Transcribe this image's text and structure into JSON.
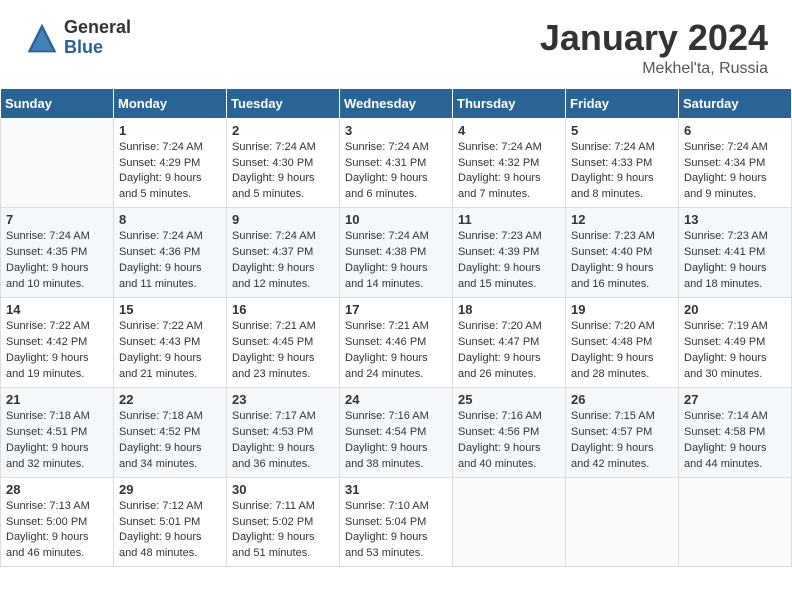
{
  "header": {
    "logo_general": "General",
    "logo_blue": "Blue",
    "month": "January 2024",
    "location": "Mekhel'ta, Russia"
  },
  "weekdays": [
    "Sunday",
    "Monday",
    "Tuesday",
    "Wednesday",
    "Thursday",
    "Friday",
    "Saturday"
  ],
  "weeks": [
    [
      {
        "day": "",
        "info": ""
      },
      {
        "day": "1",
        "info": "Sunrise: 7:24 AM\nSunset: 4:29 PM\nDaylight: 9 hours\nand 5 minutes."
      },
      {
        "day": "2",
        "info": "Sunrise: 7:24 AM\nSunset: 4:30 PM\nDaylight: 9 hours\nand 5 minutes."
      },
      {
        "day": "3",
        "info": "Sunrise: 7:24 AM\nSunset: 4:31 PM\nDaylight: 9 hours\nand 6 minutes."
      },
      {
        "day": "4",
        "info": "Sunrise: 7:24 AM\nSunset: 4:32 PM\nDaylight: 9 hours\nand 7 minutes."
      },
      {
        "day": "5",
        "info": "Sunrise: 7:24 AM\nSunset: 4:33 PM\nDaylight: 9 hours\nand 8 minutes."
      },
      {
        "day": "6",
        "info": "Sunrise: 7:24 AM\nSunset: 4:34 PM\nDaylight: 9 hours\nand 9 minutes."
      }
    ],
    [
      {
        "day": "7",
        "info": ""
      },
      {
        "day": "8",
        "info": "Sunrise: 7:24 AM\nSunset: 4:36 PM\nDaylight: 9 hours\nand 11 minutes."
      },
      {
        "day": "9",
        "info": "Sunrise: 7:24 AM\nSunset: 4:37 PM\nDaylight: 9 hours\nand 12 minutes."
      },
      {
        "day": "10",
        "info": "Sunrise: 7:24 AM\nSunset: 4:38 PM\nDaylight: 9 hours\nand 14 minutes."
      },
      {
        "day": "11",
        "info": "Sunrise: 7:23 AM\nSunset: 4:39 PM\nDaylight: 9 hours\nand 15 minutes."
      },
      {
        "day": "12",
        "info": "Sunrise: 7:23 AM\nSunset: 4:40 PM\nDaylight: 9 hours\nand 16 minutes."
      },
      {
        "day": "13",
        "info": "Sunrise: 7:23 AM\nSunset: 4:41 PM\nDaylight: 9 hours\nand 18 minutes."
      }
    ],
    [
      {
        "day": "14",
        "info": ""
      },
      {
        "day": "15",
        "info": "Sunrise: 7:22 AM\nSunset: 4:43 PM\nDaylight: 9 hours\nand 21 minutes."
      },
      {
        "day": "16",
        "info": "Sunrise: 7:21 AM\nSunset: 4:45 PM\nDaylight: 9 hours\nand 23 minutes."
      },
      {
        "day": "17",
        "info": "Sunrise: 7:21 AM\nSunset: 4:46 PM\nDaylight: 9 hours\nand 24 minutes."
      },
      {
        "day": "18",
        "info": "Sunrise: 7:20 AM\nSunset: 4:47 PM\nDaylight: 9 hours\nand 26 minutes."
      },
      {
        "day": "19",
        "info": "Sunrise: 7:20 AM\nSunset: 4:48 PM\nDaylight: 9 hours\nand 28 minutes."
      },
      {
        "day": "20",
        "info": "Sunrise: 7:19 AM\nSunset: 4:49 PM\nDaylight: 9 hours\nand 30 minutes."
      }
    ],
    [
      {
        "day": "21",
        "info": ""
      },
      {
        "day": "22",
        "info": "Sunrise: 7:18 AM\nSunset: 4:52 PM\nDaylight: 9 hours\nand 34 minutes."
      },
      {
        "day": "23",
        "info": "Sunrise: 7:17 AM\nSunset: 4:53 PM\nDaylight: 9 hours\nand 36 minutes."
      },
      {
        "day": "24",
        "info": "Sunrise: 7:16 AM\nSunset: 4:54 PM\nDaylight: 9 hours\nand 38 minutes."
      },
      {
        "day": "25",
        "info": "Sunrise: 7:16 AM\nSunset: 4:56 PM\nDaylight: 9 hours\nand 40 minutes."
      },
      {
        "day": "26",
        "info": "Sunrise: 7:15 AM\nSunset: 4:57 PM\nDaylight: 9 hours\nand 42 minutes."
      },
      {
        "day": "27",
        "info": "Sunrise: 7:14 AM\nSunset: 4:58 PM\nDaylight: 9 hours\nand 44 minutes."
      }
    ],
    [
      {
        "day": "28",
        "info": "Sunrise: 7:13 AM\nSunset: 5:00 PM\nDaylight: 9 hours\nand 46 minutes."
      },
      {
        "day": "29",
        "info": "Sunrise: 7:12 AM\nSunset: 5:01 PM\nDaylight: 9 hours\nand 48 minutes."
      },
      {
        "day": "30",
        "info": "Sunrise: 7:11 AM\nSunset: 5:02 PM\nDaylight: 9 hours\nand 51 minutes."
      },
      {
        "day": "31",
        "info": "Sunrise: 7:10 AM\nSunset: 5:04 PM\nDaylight: 9 hours\nand 53 minutes."
      },
      {
        "day": "",
        "info": ""
      },
      {
        "day": "",
        "info": ""
      },
      {
        "day": "",
        "info": ""
      }
    ]
  ],
  "week1_sunday": "Sunrise: 7:24 AM\nSunset: 4:35 PM\nDaylight: 9 hours\nand 10 minutes.",
  "week3_sunday": "Sunrise: 7:22 AM\nSunset: 4:42 PM\nDaylight: 9 hours\nand 19 minutes.",
  "week4_sunday": "Sunrise: 7:18 AM\nSunset: 4:51 PM\nDaylight: 9 hours\nand 32 minutes."
}
